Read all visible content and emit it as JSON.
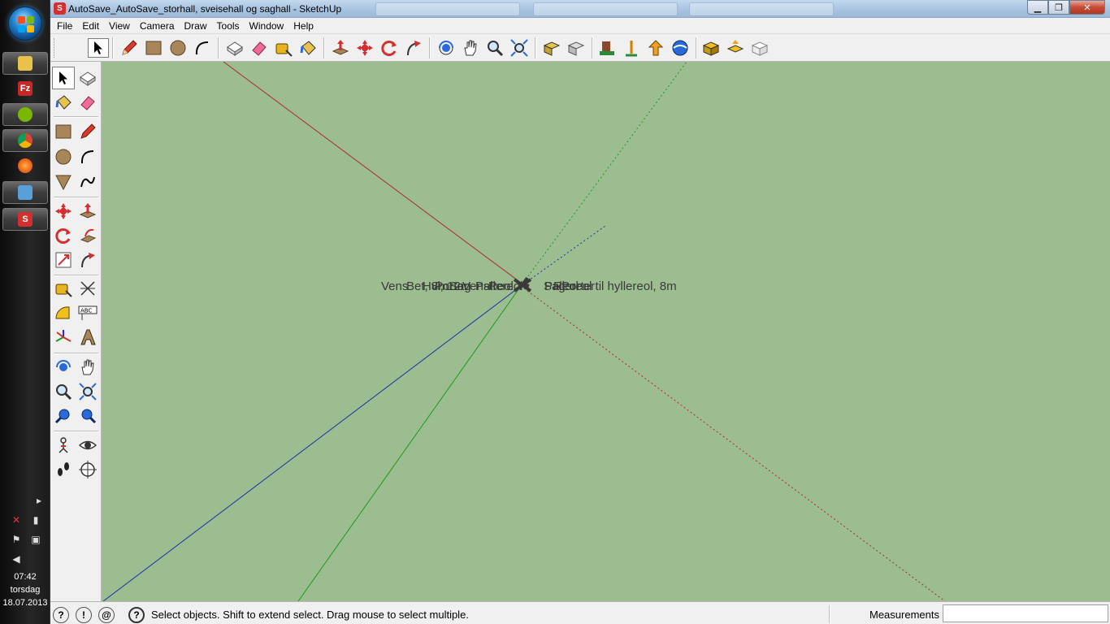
{
  "window": {
    "title": "AutoSave_AutoSave_storhall, sveisehall og saghall - SketchUp",
    "app_icon_letter": "S"
  },
  "menu": [
    "File",
    "Edit",
    "View",
    "Camera",
    "Draw",
    "Tools",
    "Window",
    "Help"
  ],
  "toolbar_icons": [
    "select-icon",
    "pencil-icon",
    "rectangle-icon",
    "circle-icon",
    "arc-icon",
    "make-component-icon",
    "eraser-icon",
    "tape-measure-icon",
    "paint-bucket-icon",
    "push-pull-icon",
    "move-icon",
    "rotate-icon",
    "follow-me-icon",
    "orbit-icon",
    "pan-icon",
    "zoom-icon",
    "zoom-extents-icon",
    "get-models-icon",
    "share-model-icon",
    "components-icon",
    "photo-textures-icon",
    "preview-google-earth-icon",
    "iso-view-icon",
    "top-view-icon",
    "front-view-icon"
  ],
  "left_toolbar_icons": [
    "select-icon",
    "make-component-icon",
    "paint-bucket-icon",
    "eraser-icon",
    "rectangle-icon",
    "line-icon",
    "circle-icon",
    "arc-icon",
    "polygon-icon",
    "freehand-icon",
    "move-icon",
    "push-pull-icon",
    "rotate-icon",
    "follow-me-icon",
    "scale-icon",
    "offset-icon",
    "tape-measure-icon",
    "dimension-icon",
    "protractor-icon",
    "text-icon",
    "axes-icon",
    "3d-text-icon",
    "orbit-icon",
    "pan-icon",
    "zoom-icon",
    "zoom-window-icon",
    "previous-view-icon",
    "next-view-icon",
    "position-camera-icon",
    "look-around-icon",
    "walk-icon",
    "section-plane-icon"
  ],
  "viewport": {
    "background": "#9bbd8f",
    "label_right": "Pallereol til hyllereol, 8m",
    "label_left_prefix": "Vens",
    "overlapping_text": [
      "Bet, 8m",
      "Hvl, 12m",
      "Porter",
      "Sag",
      "Venstre",
      "Pallereol",
      "Reol"
    ]
  },
  "status": {
    "message": "Select objects. Shift to extend select. Drag mouse to select multiple.",
    "measurements_label": "Measurements",
    "measurements_value": ""
  },
  "taskbar": {
    "apps": [
      "explorer-icon",
      "filezilla-icon",
      "spotify-icon",
      "chrome-icon",
      "firefox-icon",
      "network-icon",
      "sketchup-icon"
    ],
    "time": "07:42",
    "day": "torsdag",
    "date": "18.07.2013"
  },
  "colors": {
    "red_axis": "#b22a2a",
    "green_axis": "#1f9a1f",
    "blue_axis": "#1f2fa8",
    "label_text": "#3a3a3a"
  }
}
